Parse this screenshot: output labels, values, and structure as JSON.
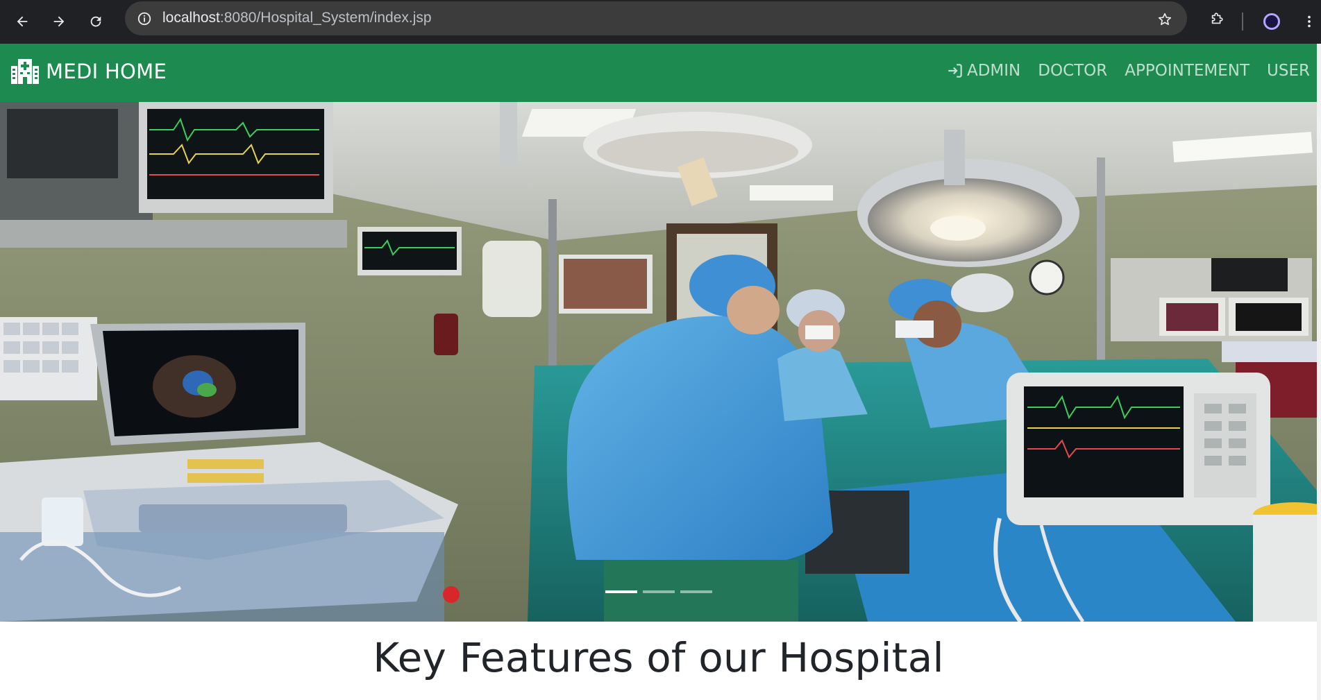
{
  "browser": {
    "url_host": "localhost",
    "url_path": ":8080/Hospital_System/index.jsp",
    "icons": {
      "back": "arrow-left-icon",
      "forward": "arrow-right-icon",
      "reload": "reload-icon",
      "site_info": "info-icon",
      "bookmark": "star-icon",
      "extensions": "puzzle-icon",
      "profile": "profile-avatar",
      "menu": "kebab-menu-icon"
    }
  },
  "navbar": {
    "brand": "MEDI HOME",
    "brand_icon": "hospital-icon",
    "bg_color": "#1d8a50",
    "links": [
      {
        "label": "ADMIN",
        "icon": "login-arrow-icon"
      },
      {
        "label": "DOCTOR"
      },
      {
        "label": "APPOINTEMENT"
      },
      {
        "label": "USER"
      }
    ]
  },
  "carousel": {
    "image_alt": "Surgeons operating in a hospital operating room",
    "slide_count": 3,
    "active_slide": 1
  },
  "main": {
    "heading": "Key Features of our Hospital"
  }
}
